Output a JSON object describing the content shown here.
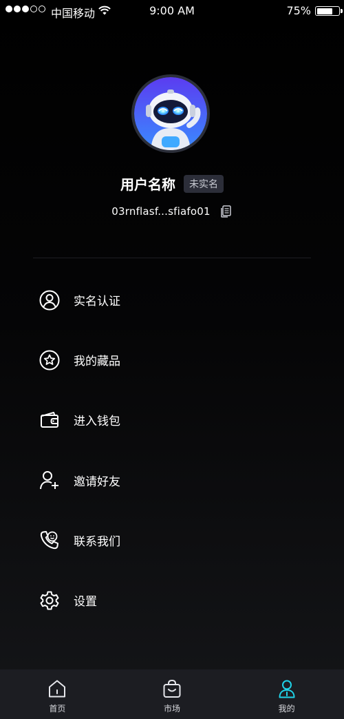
{
  "status_bar": {
    "carrier": "中国移动",
    "time": "9:00 AM",
    "battery": "75%",
    "battery_level": 0.75,
    "signal_strength": 3,
    "signal_max": 5
  },
  "profile": {
    "username": "用户名称",
    "verify_status": "未实名",
    "address": "03rnflasf...sfiafo01",
    "avatar_icon": "robot-avatar"
  },
  "menu": {
    "items": [
      {
        "label": "实名认证",
        "icon": "user-circle-icon"
      },
      {
        "label": "我的藏品",
        "icon": "star-circle-icon"
      },
      {
        "label": "进入钱包",
        "icon": "wallet-icon"
      },
      {
        "label": "邀请好友",
        "icon": "user-add-icon"
      },
      {
        "label": "联系我们",
        "icon": "phone-icon"
      },
      {
        "label": "设置",
        "icon": "gear-icon"
      }
    ]
  },
  "tab_bar": {
    "tabs": [
      {
        "label": "首页",
        "icon": "home-icon",
        "active": false
      },
      {
        "label": "市场",
        "icon": "bag-icon",
        "active": false
      },
      {
        "label": "我的",
        "icon": "user-icon",
        "active": true
      }
    ]
  },
  "colors": {
    "background": "#000000",
    "active_tab": "#1fd3e8",
    "badge_bg": "#2c2e39",
    "tab_bar_bg": "#1c1d22"
  }
}
